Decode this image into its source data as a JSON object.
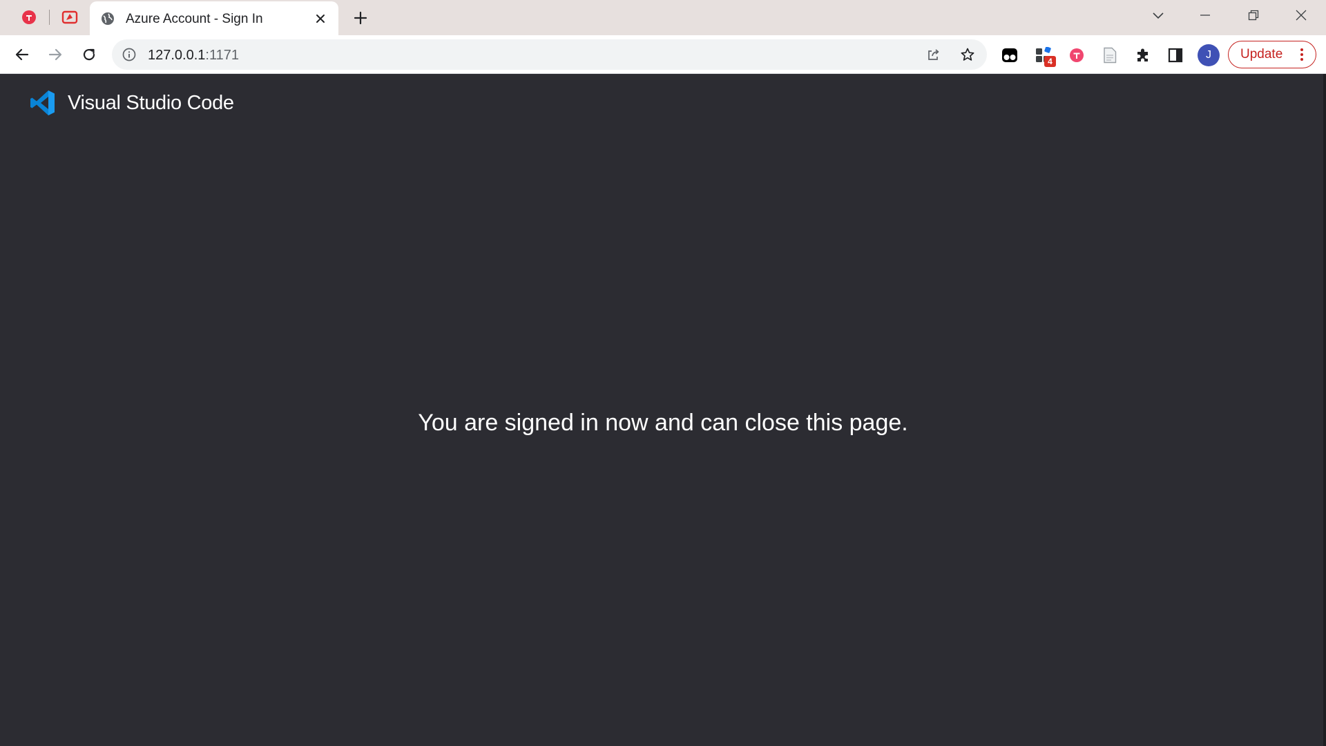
{
  "browser": {
    "pinned_tabs": [
      {
        "icon": "tomato-extension-icon",
        "color": "#e8334a"
      },
      {
        "icon": "pdf-app-icon",
        "color": "#e02f2f"
      }
    ],
    "active_tab": {
      "title": "Azure Account - Sign In",
      "favicon": "globe-icon"
    },
    "window_controls": [
      "search-tabs",
      "minimize",
      "restore",
      "close"
    ],
    "address": {
      "host": "127.0.0.1",
      "port": ":1171"
    },
    "extensions": [
      {
        "icon": "tampermonkey-icon"
      },
      {
        "icon": "apps-extension-icon",
        "badge": "4"
      },
      {
        "icon": "tomato-extension-icon"
      },
      {
        "icon": "document-icon"
      },
      {
        "icon": "puzzle-icon"
      },
      {
        "icon": "side-panel-icon"
      }
    ],
    "profile_initial": "J",
    "update_label": "Update",
    "accent_color": "#c5221f"
  },
  "page": {
    "brand_name": "Visual Studio Code",
    "message": "You are signed in now and can close this page.",
    "background_color": "#2c2c32",
    "logo_color": "#0a84d6"
  }
}
